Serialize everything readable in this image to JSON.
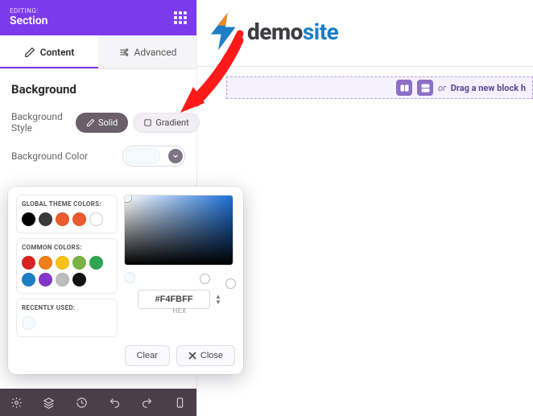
{
  "header": {
    "editing_label": "EDITING:",
    "title": "Section"
  },
  "tabs": {
    "content": "Content",
    "advanced": "Advanced"
  },
  "background": {
    "heading": "Background",
    "style_label": "Background Style",
    "solid_label": "Solid",
    "gradient_label": "Gradient",
    "color_label": "Background Color"
  },
  "color_picker": {
    "global_title": "GLOBAL THEME COLORS:",
    "common_title": "COMMON COLORS:",
    "recent_title": "RECENTLY USED:",
    "hex_value": "#F4FBFF",
    "hex_label": "HEX",
    "clear_label": "Clear",
    "close_label": "Close",
    "global_colors": [
      "#000000",
      "#3a3a3a",
      "#e85c2d",
      "#e85c2d",
      "#ffffff"
    ],
    "common_colors": [
      "#d62222",
      "#f07f1b",
      "#f6c218",
      "#7bb342",
      "#2fa64f",
      "#1d7dc5",
      "#8236c9",
      "#bdbdbd",
      "#111111"
    ],
    "recent_colors": [
      "#f4fbff"
    ]
  },
  "logo": {
    "demo": "demo",
    "site": "site"
  },
  "dropzone": {
    "or": "or",
    "text": "Drag a new block h"
  }
}
